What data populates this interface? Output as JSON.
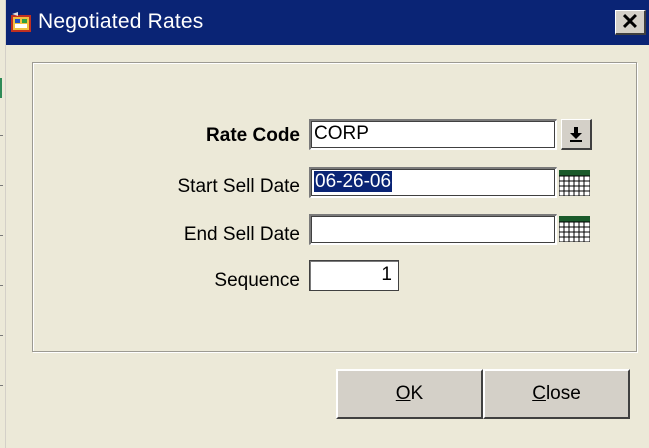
{
  "window": {
    "title": "Negotiated Rates"
  },
  "form": {
    "rate_code_label": "Rate Code",
    "rate_code_value": "CORP",
    "start_sell_date_label": "Start Sell Date",
    "start_sell_date_value": "06-26-06",
    "end_sell_date_label": "End Sell Date",
    "end_sell_date_value": "",
    "sequence_label": "Sequence",
    "sequence_value": "1"
  },
  "buttons": {
    "ok_mnemonic": "O",
    "ok_rest": "K",
    "close_mnemonic": "C",
    "close_rest": "lose"
  },
  "icons": {
    "app": "app-icon",
    "close": "close-icon",
    "dropdown": "dropdown-arrow-icon",
    "calendar": "calendar-icon"
  },
  "colors": {
    "titlebar": "#0a2475",
    "dialog_bg": "#ece9d8",
    "selection": "#0a2475"
  }
}
